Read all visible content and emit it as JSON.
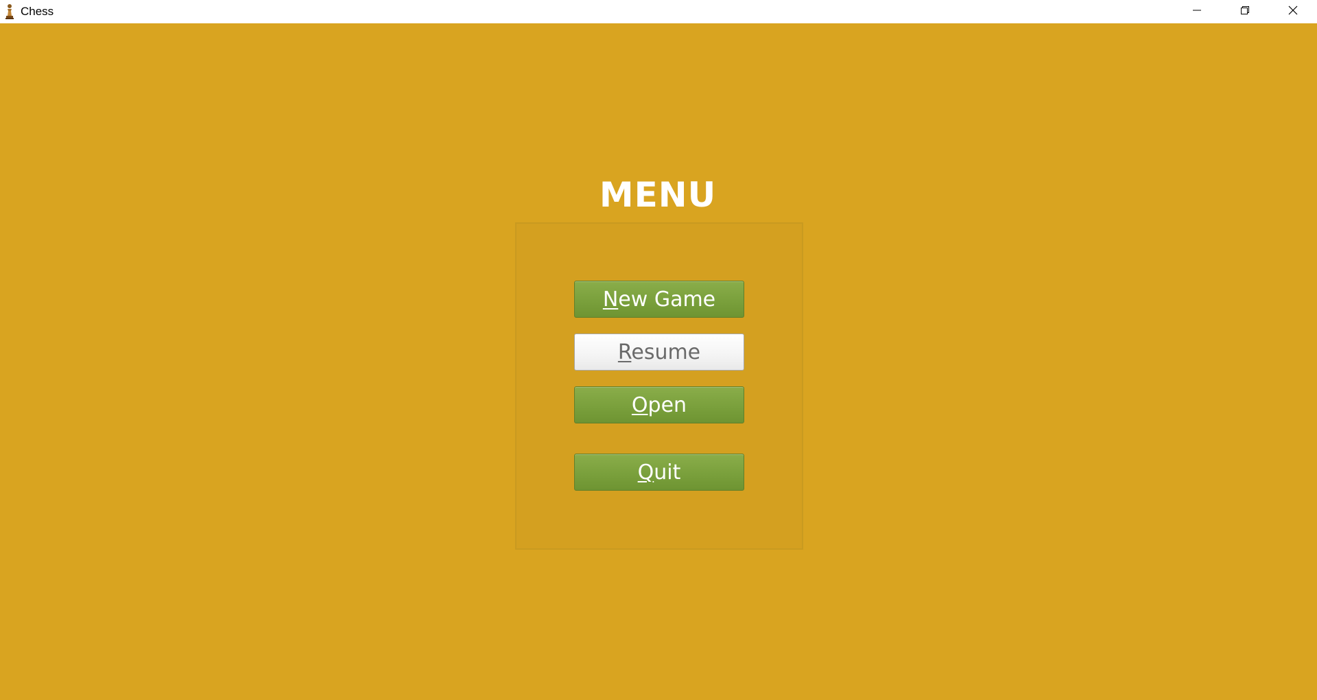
{
  "window": {
    "title": "Chess",
    "app_icon": "chess-pawn-icon",
    "controls": {
      "minimize": "minimize-icon",
      "restore": "restore-icon",
      "close": "close-icon"
    }
  },
  "menu": {
    "title": "MENU",
    "buttons": [
      {
        "id": "new-game",
        "mnemonic": "N",
        "rest": "ew Game",
        "style": "green"
      },
      {
        "id": "resume",
        "mnemonic": "R",
        "rest": "esume",
        "style": "white"
      },
      {
        "id": "open",
        "mnemonic": "O",
        "rest": "pen",
        "style": "green"
      },
      {
        "id": "quit",
        "mnemonic": "Q",
        "rest": "uit",
        "style": "green"
      }
    ]
  },
  "colors": {
    "background": "#d9a420",
    "button_green": "#7aa03c",
    "button_white": "#f4f4f4",
    "title_text": "#ffffff"
  }
}
